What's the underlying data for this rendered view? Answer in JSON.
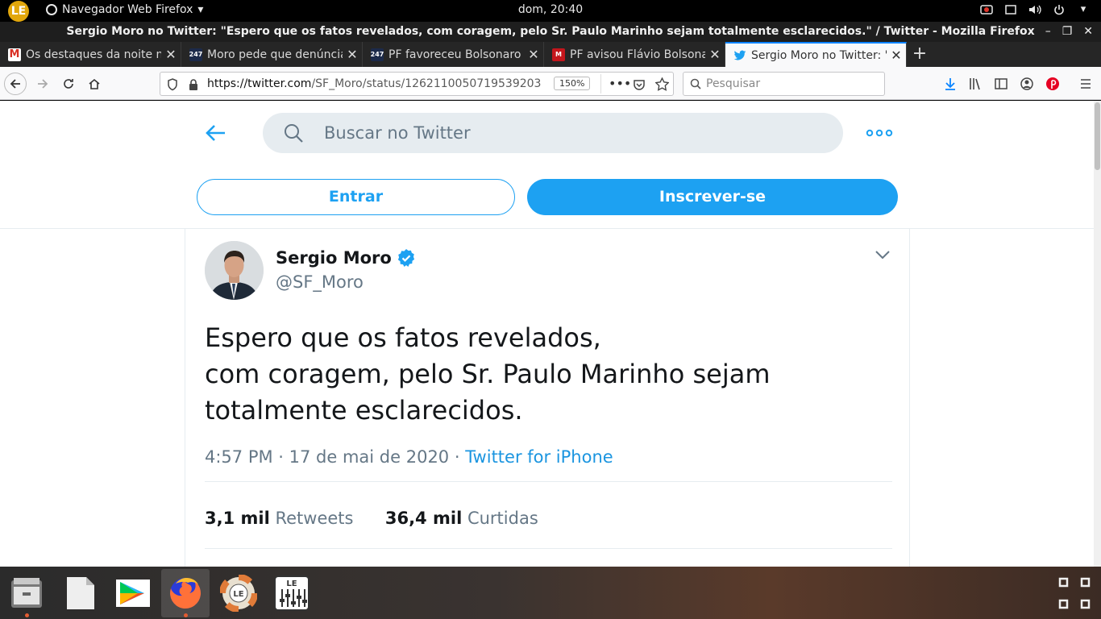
{
  "topbar": {
    "app_menu": "Navegador Web Firefox",
    "clock": "dom, 20:40",
    "logo": "LE"
  },
  "window": {
    "title": "Sergio Moro no Twitter: \"Espero que os fatos revelados, com coragem, pelo Sr. Paulo Marinho sejam totalmente esclarecidos.\" / Twitter - Mozilla Firefox"
  },
  "tabs": [
    {
      "title": "Os destaques da noite no",
      "favicon": "gmail-icon",
      "color": "#d93025"
    },
    {
      "title": "Moro pede que denúncias",
      "favicon": "247-icon",
      "color": "#1c2a4a"
    },
    {
      "title": "PF favoreceu Bolsonaro n",
      "favicon": "247-icon",
      "color": "#1c2a4a"
    },
    {
      "title": "PF avisou Flávio Bolsonar",
      "favicon": "uol-icon",
      "color": "#c4161c"
    },
    {
      "title": "Sergio Moro no Twitter: \"E",
      "favicon": "twitter-icon",
      "color": "#1da1f2"
    }
  ],
  "navbar": {
    "url_host": "https://twitter.com",
    "url_path": "/SF_Moro/status/1262110050719539203",
    "zoom": "150%",
    "search_placeholder": "Pesquisar"
  },
  "twitter": {
    "search_placeholder": "Buscar no Twitter",
    "login": "Entrar",
    "signup": "Inscrever-se",
    "accent": "#1da1f2"
  },
  "tweet": {
    "author": "Sergio Moro",
    "handle": "@SF_Moro",
    "lines": [
      "Espero que os fatos revelados,",
      "com coragem, pelo Sr. Paulo Marinho sejam",
      "totalmente esclarecidos."
    ],
    "time": "4:57 PM · 17 de mai de 2020",
    "dot": " · ",
    "source": "Twitter for iPhone",
    "retweets_count": "3,1 mil",
    "retweets_label": "Retweets",
    "likes_count": "36,4 mil",
    "likes_label": "Curtidas"
  },
  "dock": {
    "items": [
      "file-manager-icon",
      "document-viewer-icon",
      "play-store-icon",
      "firefox-icon",
      "help-lifebuoy-icon",
      "le-settings-icon"
    ]
  }
}
